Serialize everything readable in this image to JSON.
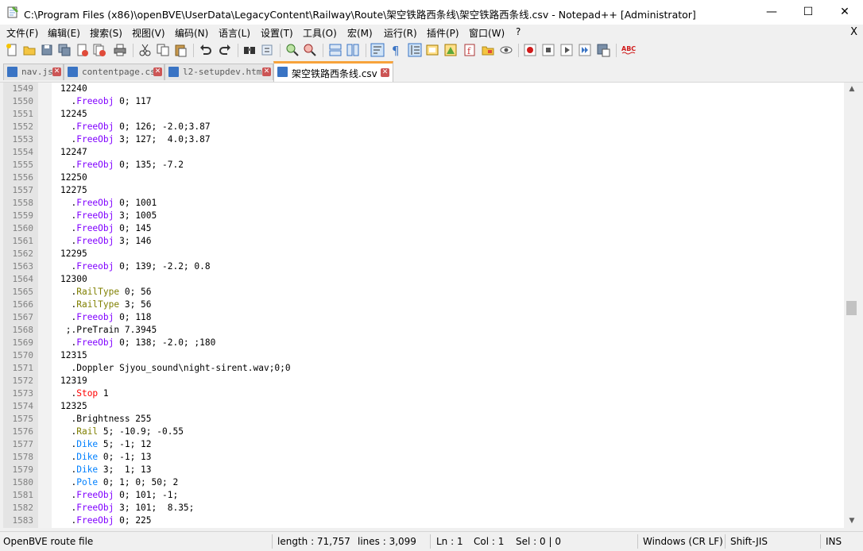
{
  "window": {
    "title": "C:\\Program Files (x86)\\openBVE\\UserData\\LegacyContent\\Railway\\Route\\架空铁路西条线\\架空铁路西条线.csv - Notepad++ [Administrator]",
    "minimize_glyph": "—",
    "maximize_glyph": "☐",
    "close_glyph": "✕"
  },
  "menu": {
    "items": [
      "文件(F)",
      "编辑(E)",
      "搜索(S)",
      "视图(V)",
      "编码(N)",
      "语言(L)",
      "设置(T)",
      "工具(O)",
      "宏(M)",
      "运行(R)",
      "插件(P)",
      "窗口(W)",
      "?"
    ],
    "close_glyph": "X"
  },
  "tabs": [
    {
      "label": "nav.js",
      "active": false
    },
    {
      "label": "contentpage.css",
      "active": false
    },
    {
      "label": "l2-setupdev.html",
      "active": false
    },
    {
      "label": "架空铁路西条线.csv",
      "active": true
    }
  ],
  "tab_close_glyph": "✕",
  "editor": {
    "lines": [
      {
        "n": "1549",
        "indent": "",
        "kw": "",
        "rest": "12240",
        "cls": ""
      },
      {
        "n": "1550",
        "indent": "  .",
        "kw": "Freeobj",
        "rest": " 0; 117",
        "cls": "kw-blue"
      },
      {
        "n": "1551",
        "indent": "",
        "kw": "",
        "rest": "12245",
        "cls": ""
      },
      {
        "n": "1552",
        "indent": "  .",
        "kw": "FreeObj",
        "rest": " 0; 126; -2.0;3.87",
        "cls": "kw-blue"
      },
      {
        "n": "1553",
        "indent": "  .",
        "kw": "FreeObj",
        "rest": " 3; 127;  4.0;3.87",
        "cls": "kw-blue"
      },
      {
        "n": "1554",
        "indent": "",
        "kw": "",
        "rest": "12247",
        "cls": ""
      },
      {
        "n": "1555",
        "indent": "  .",
        "kw": "FreeObj",
        "rest": " 0; 135; -7.2",
        "cls": "kw-blue"
      },
      {
        "n": "1556",
        "indent": "",
        "kw": "",
        "rest": "12250",
        "cls": ""
      },
      {
        "n": "1557",
        "indent": "",
        "kw": "",
        "rest": "12275",
        "cls": ""
      },
      {
        "n": "1558",
        "indent": "  .",
        "kw": "FreeObj",
        "rest": " 0; 1001",
        "cls": "kw-blue"
      },
      {
        "n": "1559",
        "indent": "  .",
        "kw": "FreeObj",
        "rest": " 3; 1005",
        "cls": "kw-blue"
      },
      {
        "n": "1560",
        "indent": "  .",
        "kw": "FreeObj",
        "rest": " 0; 145",
        "cls": "kw-blue"
      },
      {
        "n": "1561",
        "indent": "  .",
        "kw": "FreeObj",
        "rest": " 3; 146",
        "cls": "kw-blue"
      },
      {
        "n": "1562",
        "indent": "",
        "kw": "",
        "rest": "12295",
        "cls": ""
      },
      {
        "n": "1563",
        "indent": "  .",
        "kw": "Freeobj",
        "rest": " 0; 139; -2.2; 0.8",
        "cls": "kw-blue"
      },
      {
        "n": "1564",
        "indent": "",
        "kw": "",
        "rest": "12300",
        "cls": ""
      },
      {
        "n": "1565",
        "indent": "  .",
        "kw": "RailType",
        "rest": " 0; 56",
        "cls": "kw-olive"
      },
      {
        "n": "1566",
        "indent": "  .",
        "kw": "RailType",
        "rest": " 3; 56",
        "cls": "kw-olive"
      },
      {
        "n": "1567",
        "indent": "  .",
        "kw": "Freeobj",
        "rest": " 0; 118",
        "cls": "kw-blue"
      },
      {
        "n": "1568",
        "indent": " ",
        "kw": "",
        "rest": ";.PreTrain 7.3945",
        "cls": ""
      },
      {
        "n": "1569",
        "indent": "  .",
        "kw": "FreeObj",
        "rest": " 0; 138; -2.0; ;180",
        "cls": "kw-blue"
      },
      {
        "n": "1570",
        "indent": "",
        "kw": "",
        "rest": "12315",
        "cls": ""
      },
      {
        "n": "1571",
        "indent": "  ",
        "kw": "",
        "rest": ".Doppler Sjyou_sound\\night-sirent.wav;0;0",
        "cls": ""
      },
      {
        "n": "1572",
        "indent": "",
        "kw": "",
        "rest": "12319",
        "cls": ""
      },
      {
        "n": "1573",
        "indent": "  .",
        "kw": "Stop",
        "rest": " 1",
        "cls": "kw-red"
      },
      {
        "n": "1574",
        "indent": "",
        "kw": "",
        "rest": "12325",
        "cls": ""
      },
      {
        "n": "1575",
        "indent": "  ",
        "kw": "",
        "rest": ".Brightness 255",
        "cls": ""
      },
      {
        "n": "1576",
        "indent": "  .",
        "kw": "Rail",
        "rest": " 5; -10.9; -0.55",
        "cls": "kw-olive"
      },
      {
        "n": "1577",
        "indent": "  .",
        "kw": "Dike",
        "rest": " 5; -1; 12",
        "cls": "kw-cyan"
      },
      {
        "n": "1578",
        "indent": "  .",
        "kw": "Dike",
        "rest": " 0; -1; 13",
        "cls": "kw-cyan"
      },
      {
        "n": "1579",
        "indent": "  .",
        "kw": "Dike",
        "rest": " 3;  1; 13",
        "cls": "kw-cyan"
      },
      {
        "n": "1580",
        "indent": "  .",
        "kw": "Pole",
        "rest": " 0; 1; 0; 50; 2",
        "cls": "kw-cyan"
      },
      {
        "n": "1581",
        "indent": "  .",
        "kw": "FreeObj",
        "rest": " 0; 101; -1;",
        "cls": "kw-blue"
      },
      {
        "n": "1582",
        "indent": "  .",
        "kw": "FreeObj",
        "rest": " 3; 101;  8.35;",
        "cls": "kw-blue"
      },
      {
        "n": "1583",
        "indent": "  .",
        "kw": "FreeObj",
        "rest": " 0; 225",
        "cls": "kw-blue"
      }
    ]
  },
  "status": {
    "file_type": "OpenBVE route file",
    "length": "length : 71,757",
    "lines": "lines : 3,099",
    "ln": "Ln : 1",
    "col": "Col : 1",
    "sel": "Sel : 0 | 0",
    "eol": "Windows (CR LF)",
    "encoding": "Shift-JIS",
    "mode": "INS"
  },
  "colors": {
    "keyword_purple": "#8000ff",
    "keyword_blue": "#0080ff",
    "keyword_olive": "#808000",
    "keyword_red": "#ff0000",
    "active_tab_accent": "#f7a33b"
  }
}
